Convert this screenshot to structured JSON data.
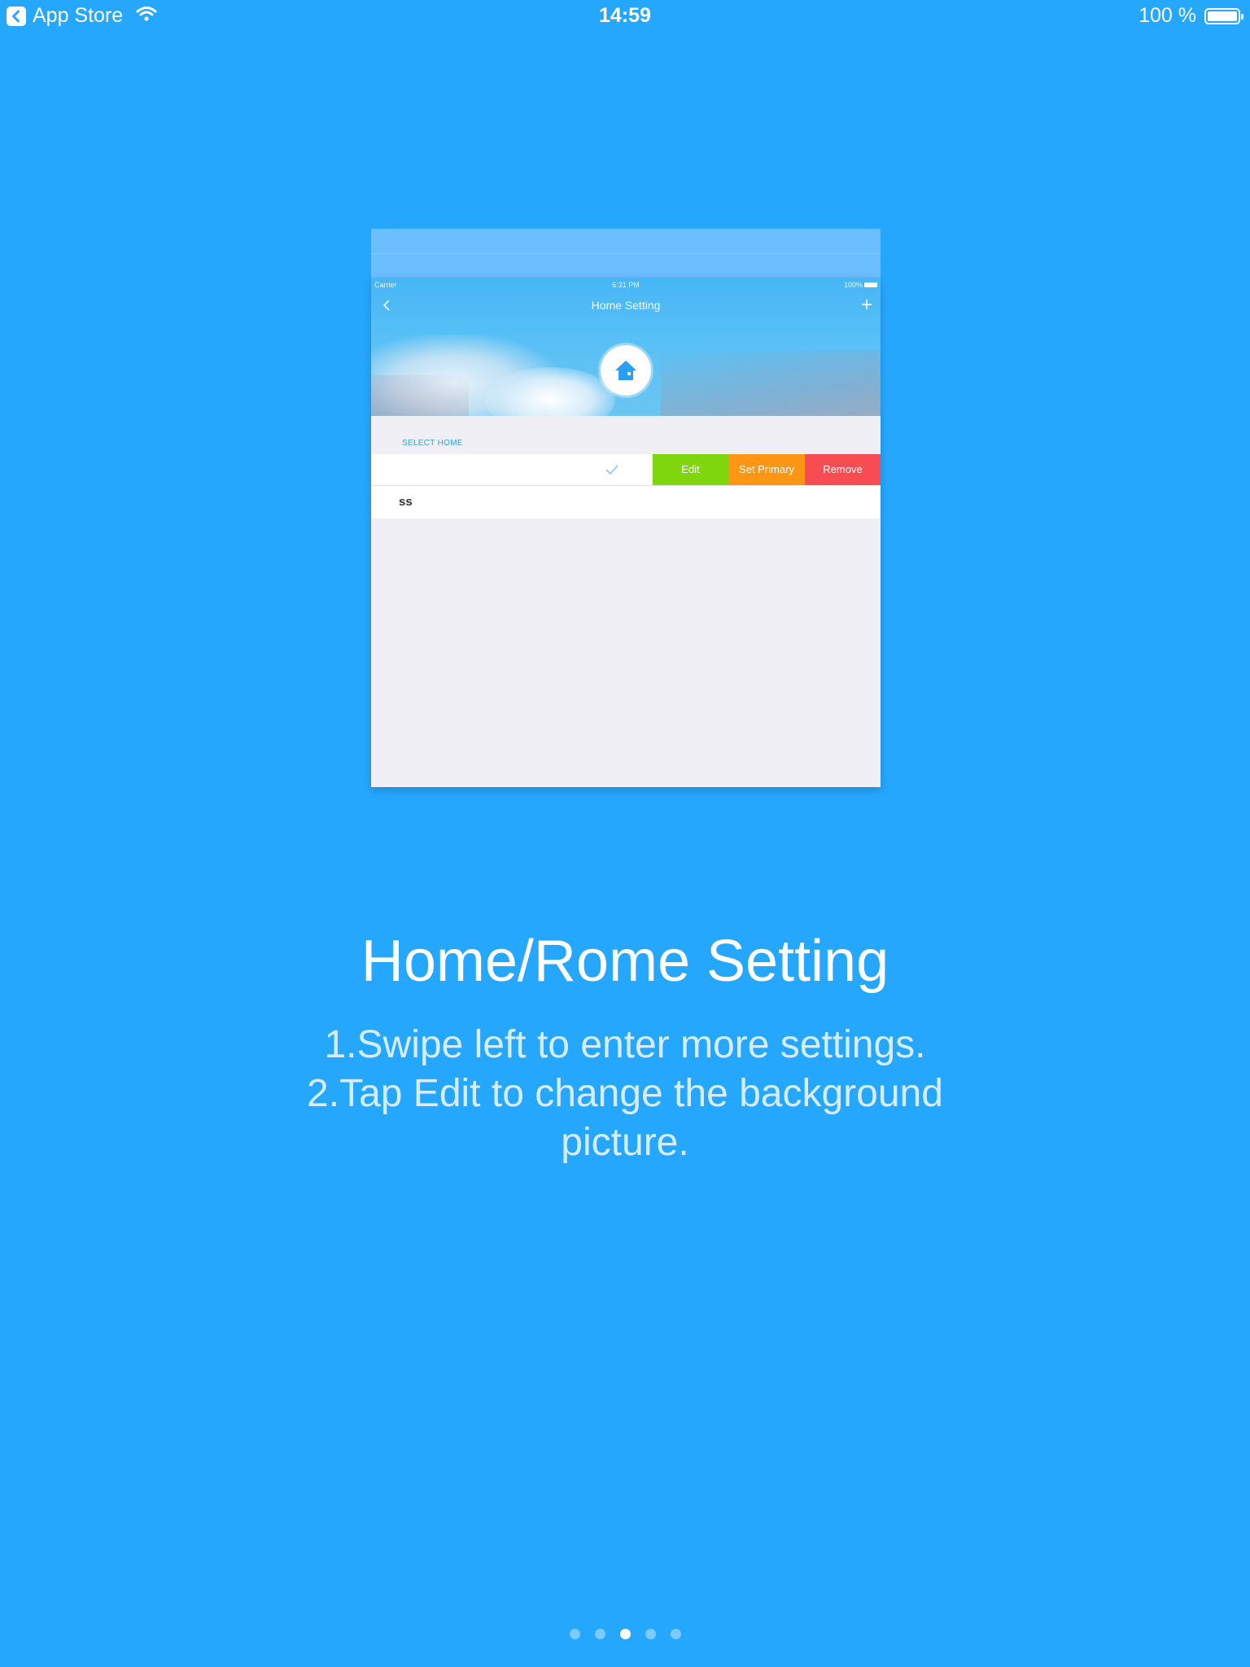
{
  "status_bar": {
    "back_app": "App Store",
    "time": "14:59",
    "battery": "100 %"
  },
  "preview": {
    "mini_status": {
      "carrier": "Carrier",
      "time": "6:31 PM",
      "battery": "100%"
    },
    "header_title": "Home Setting",
    "add_symbol": "+",
    "section_label": "SELECT HOME",
    "row_actions": {
      "edit": "Edit",
      "set_primary": "Set Primary",
      "remove": "Remove"
    },
    "second_row": "ss"
  },
  "title": "Home/Rome Setting",
  "description": {
    "line1": "1.Swipe left to enter more settings.",
    "line2": "2.Tap Edit to change the background picture."
  },
  "page_indicator": {
    "count": 5,
    "active_index": 2
  },
  "colors": {
    "background": "#26a7fe",
    "edit": "#7fd60c",
    "set_primary": "#fc9613",
    "remove": "#f74c51"
  }
}
